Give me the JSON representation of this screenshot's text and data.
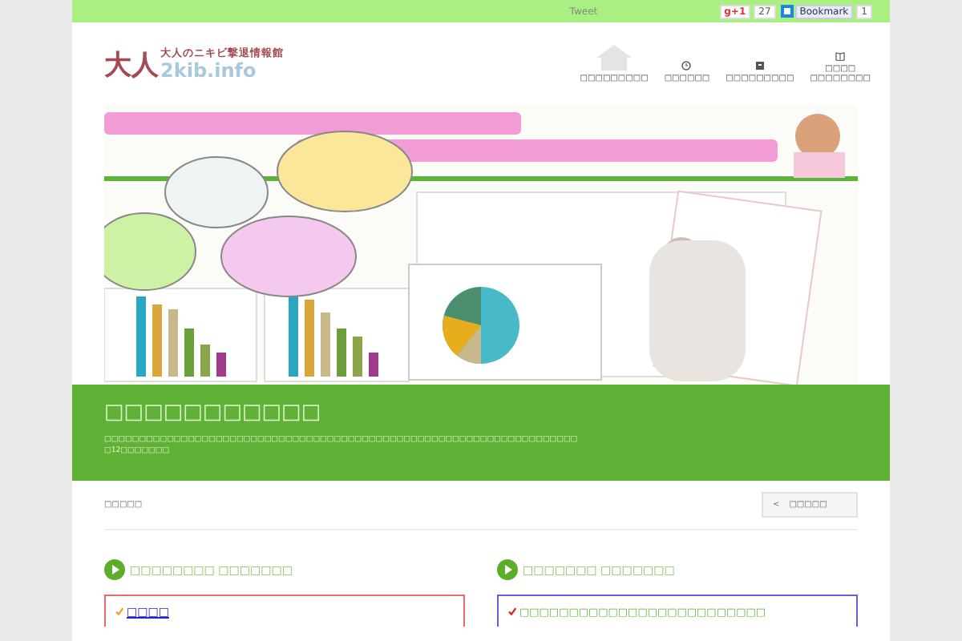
{
  "top_bar": {
    "tweet": "Tweet",
    "gplus": {
      "label": "g+1",
      "count": "27"
    },
    "hatena": {
      "label": "Bookmark",
      "count": "1"
    }
  },
  "header": {
    "logo": {
      "big": "大人",
      "title": "大人のニキビ撃退情報館",
      "domain": "2kib.info"
    },
    "nav": [
      {
        "lines": [
          "□□□□□□□□□"
        ]
      },
      {
        "lines": [
          "□□□□□□"
        ]
      },
      {
        "lines": [
          "□□□□□□□□□"
        ]
      },
      {
        "lines": [
          "□□□□",
          "□□□□□□□□"
        ]
      }
    ]
  },
  "hero": {
    "title": "□□□□□□□□□□□",
    "lines": [
      "□□□□□□□□□□□□□□□□□□□□□□□□□□□□□□□□□□□□□□□□□□□□□□□□□□□□□□□□□□□□□□□□□□□□",
      "□12□□□□□□□"
    ]
  },
  "breadcrumb": {
    "text": "□□□□□",
    "back": {
      "arrow": "<",
      "label": "□□□□□"
    }
  },
  "sections": [
    {
      "heading": "□□□□□□□□ □□□□□□□",
      "items": [
        {
          "kind": "link",
          "text": "□□□□"
        }
      ]
    },
    {
      "heading": "□□□□□□□ □□□□□□□",
      "items": [
        {
          "kind": "text",
          "text": "□□□□□□□□□□□□□□□□□□□□□□□□□"
        }
      ]
    }
  ]
}
